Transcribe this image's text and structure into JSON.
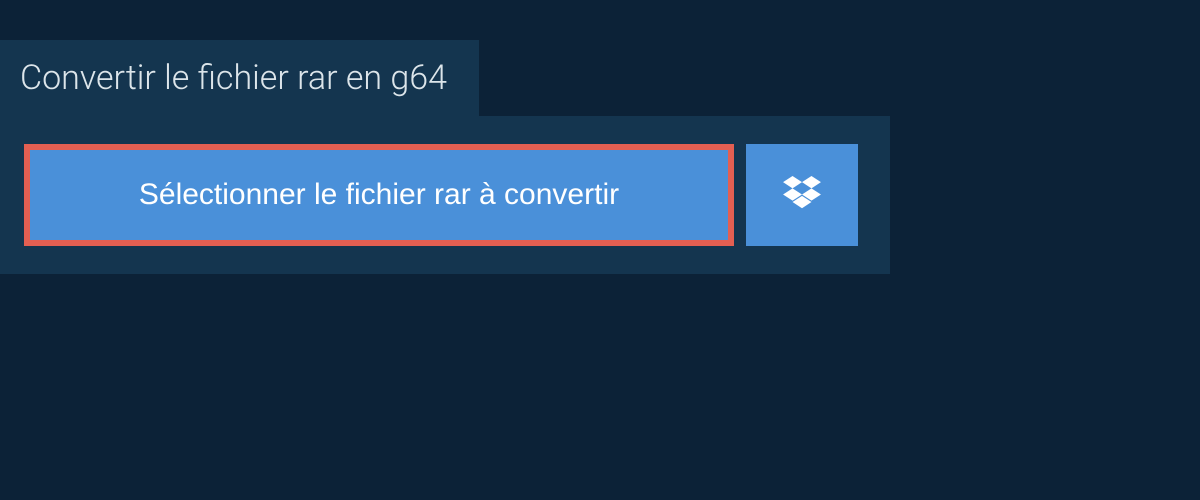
{
  "header": {
    "title": "Convertir le fichier rar en g64"
  },
  "actions": {
    "select_file_label": "Sélectionner le fichier rar à convertir",
    "dropbox_icon": "dropbox"
  },
  "colors": {
    "background": "#0c2237",
    "panel": "#14354f",
    "button": "#4a90d9",
    "highlight_border": "#e35f52",
    "text_light": "#dce5ea"
  }
}
